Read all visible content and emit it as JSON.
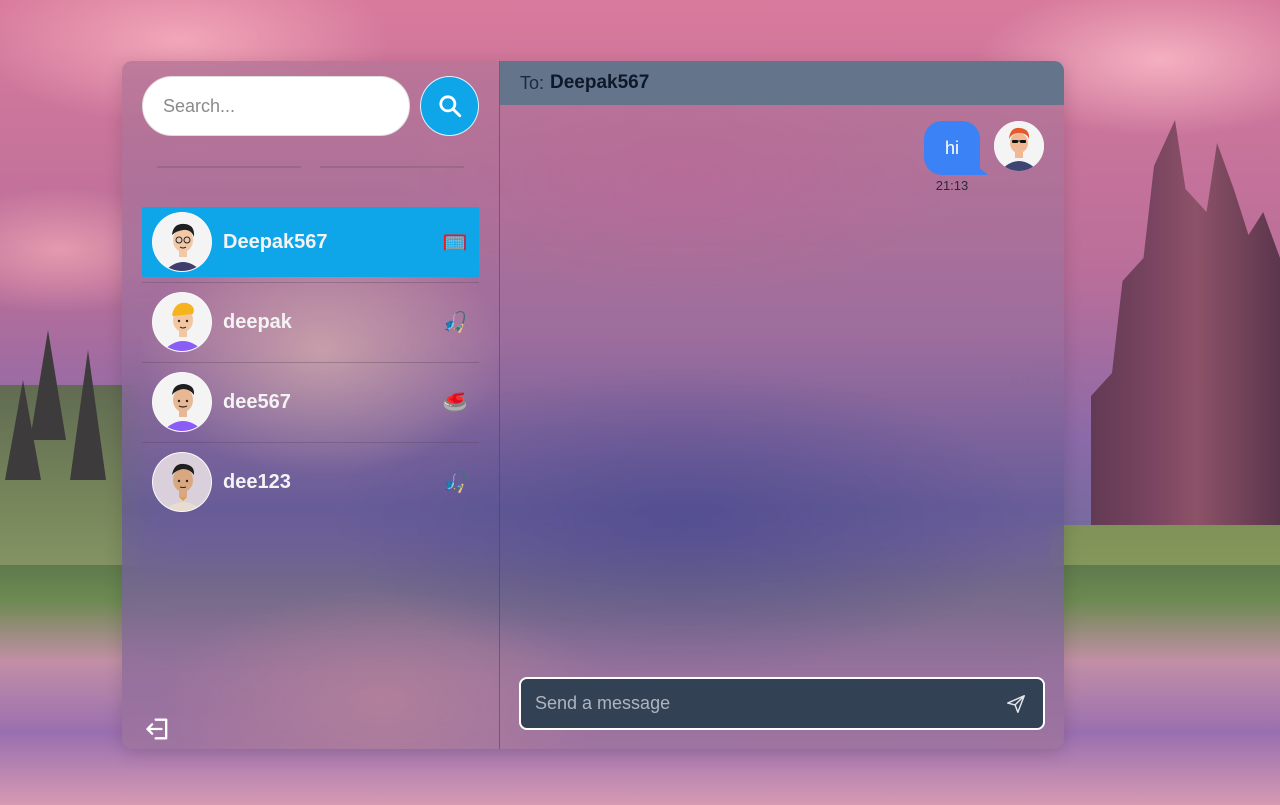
{
  "search": {
    "placeholder": "Search..."
  },
  "conversations": [
    {
      "name": "Deepak567",
      "emoji": "🥅",
      "active": true
    },
    {
      "name": "deepak",
      "emoji": "🎣",
      "active": false
    },
    {
      "name": "dee567",
      "emoji": "🥌",
      "active": false
    },
    {
      "name": "dee123",
      "emoji": "🎣",
      "active": false
    }
  ],
  "chat": {
    "to_label": "To:",
    "to_name": "Deepak567",
    "messages": [
      {
        "text": "hi",
        "time": "21:13",
        "from_me": true
      }
    ],
    "composer_placeholder": "Send a message"
  },
  "colors": {
    "accent": "#0ea5e9",
    "bubble": "#3b82f6",
    "header": "#64748b",
    "composer": "#334155"
  },
  "icons": {
    "search": "search-icon",
    "logout": "logout-icon",
    "send": "send-icon"
  }
}
